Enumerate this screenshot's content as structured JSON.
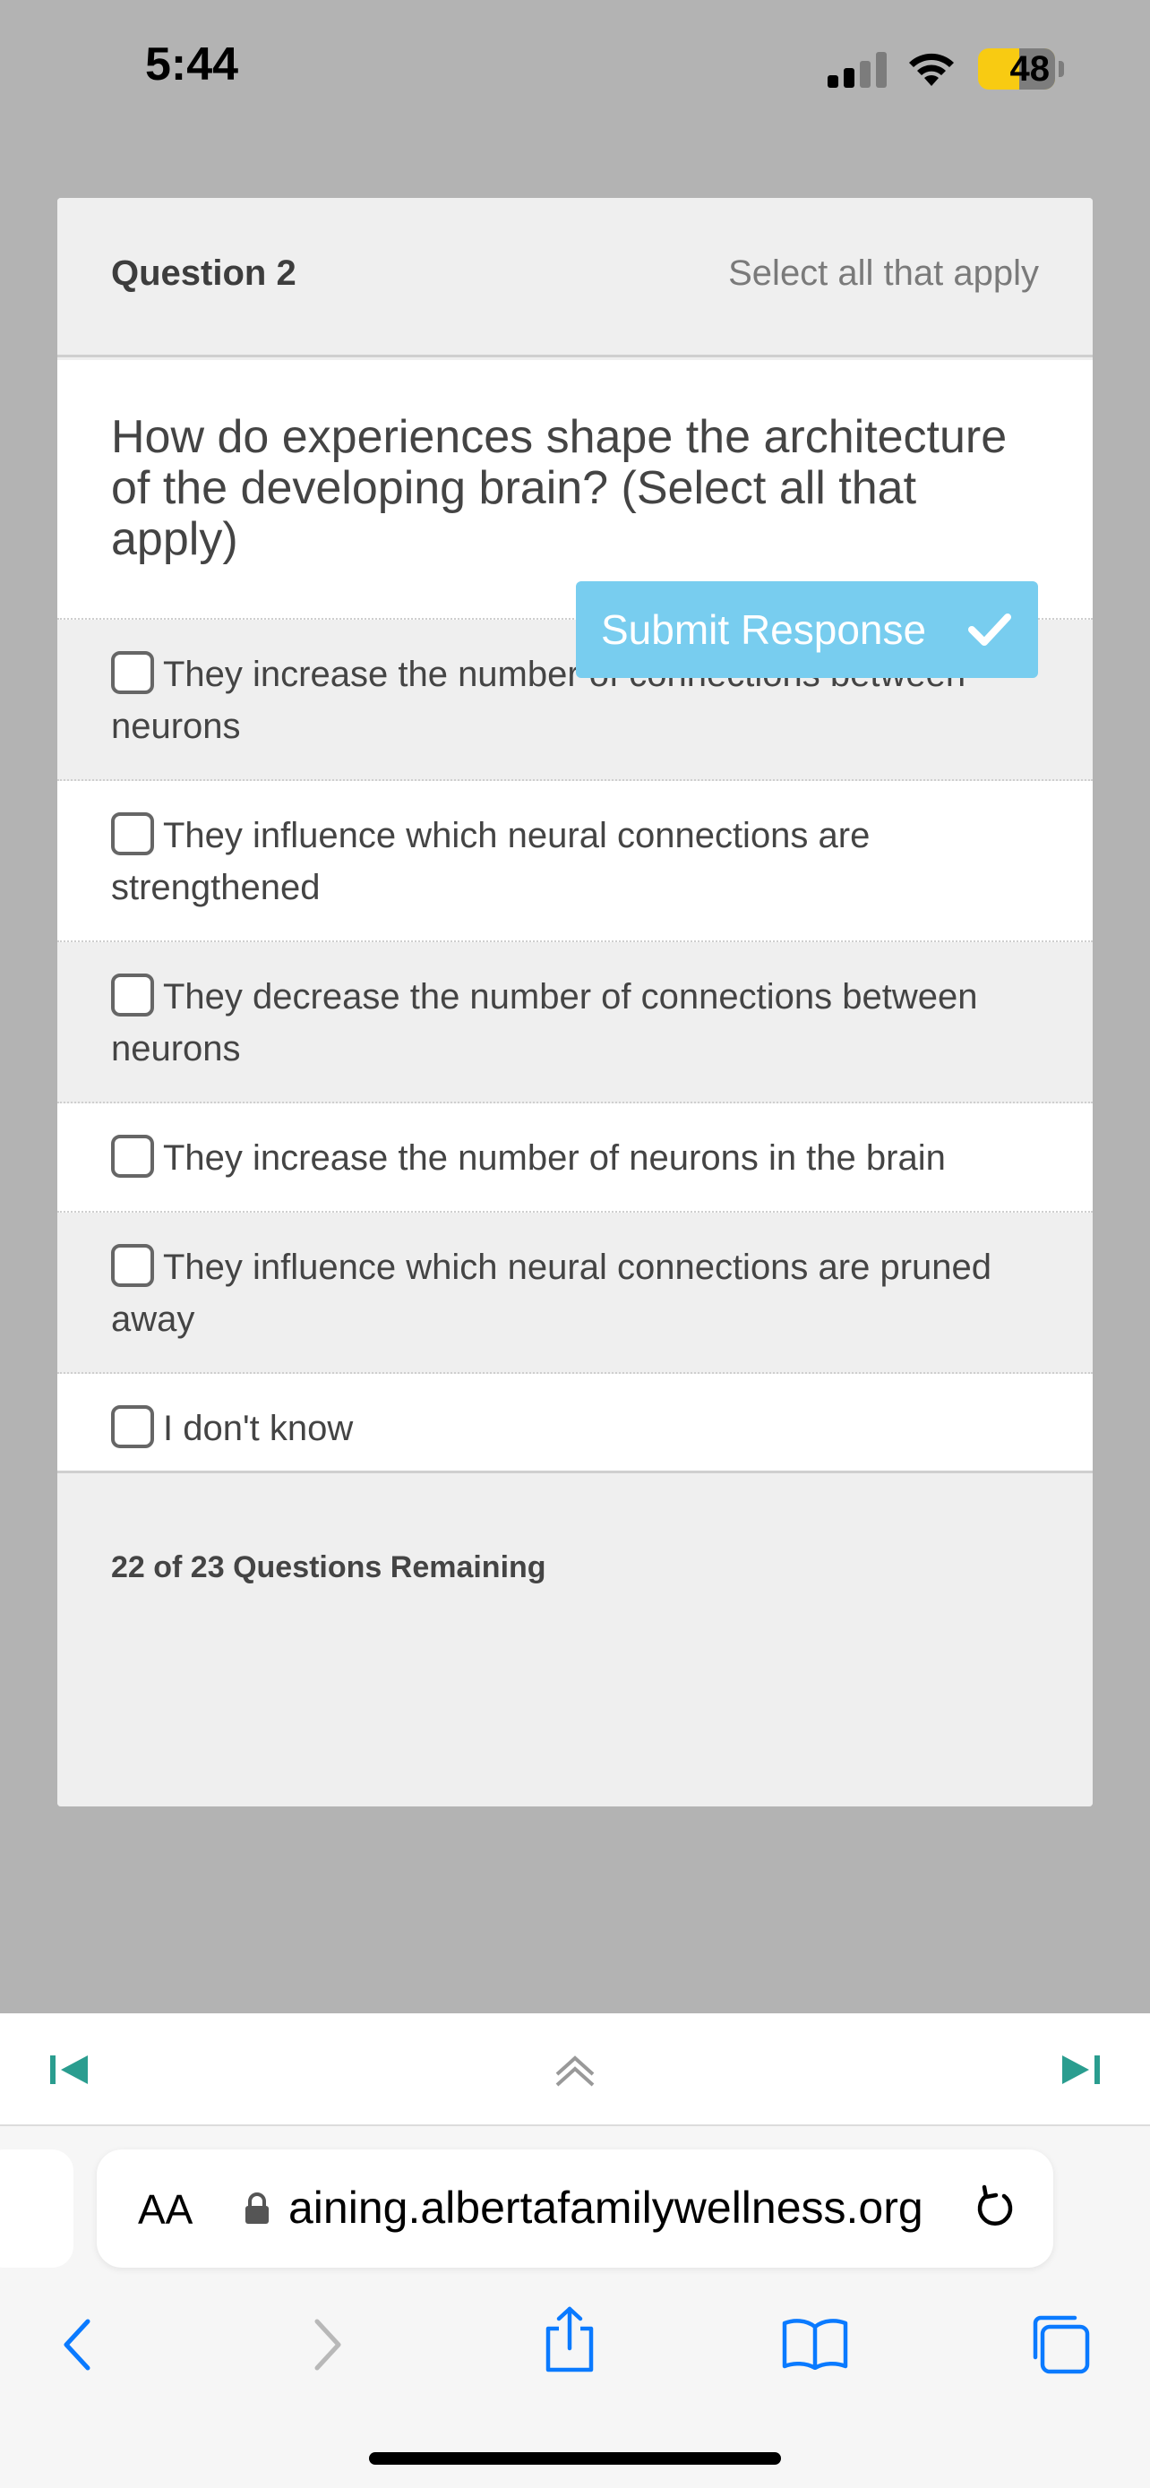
{
  "status_bar": {
    "time": "5:44",
    "battery": "48"
  },
  "question": {
    "label": "Question 2",
    "hint": "Select all that apply",
    "text": "How do experiences shape the architecture of the developing brain? (Select all that apply)"
  },
  "options": [
    {
      "label": "They increase the number of connections between neurons",
      "checked": false
    },
    {
      "label": "They influence which neural connections are strengthened",
      "checked": false
    },
    {
      "label": "They decrease the number of connections between neurons",
      "checked": false
    },
    {
      "label": "They increase the number of neurons in the brain",
      "checked": false
    },
    {
      "label": "They influence which neural connections are pruned away",
      "checked": false
    },
    {
      "label": "I don't know",
      "checked": false
    }
  ],
  "footer": {
    "remaining": "22 of 23 Questions Remaining",
    "submit_label": "Submit Response"
  },
  "browser": {
    "aa_label": "AA",
    "url": "aining.albertafamilywellness.org"
  },
  "colors": {
    "accent_teal": "#2a9d8f",
    "submit_blue": "#78cdef",
    "ios_blue": "#0a7aff"
  },
  "icons": [
    "skip-to-first-icon",
    "collapse-up-icon",
    "skip-to-last-icon",
    "lock-icon",
    "reload-icon",
    "back-icon",
    "forward-icon",
    "share-icon",
    "bookmarks-icon",
    "tabs-icon"
  ]
}
